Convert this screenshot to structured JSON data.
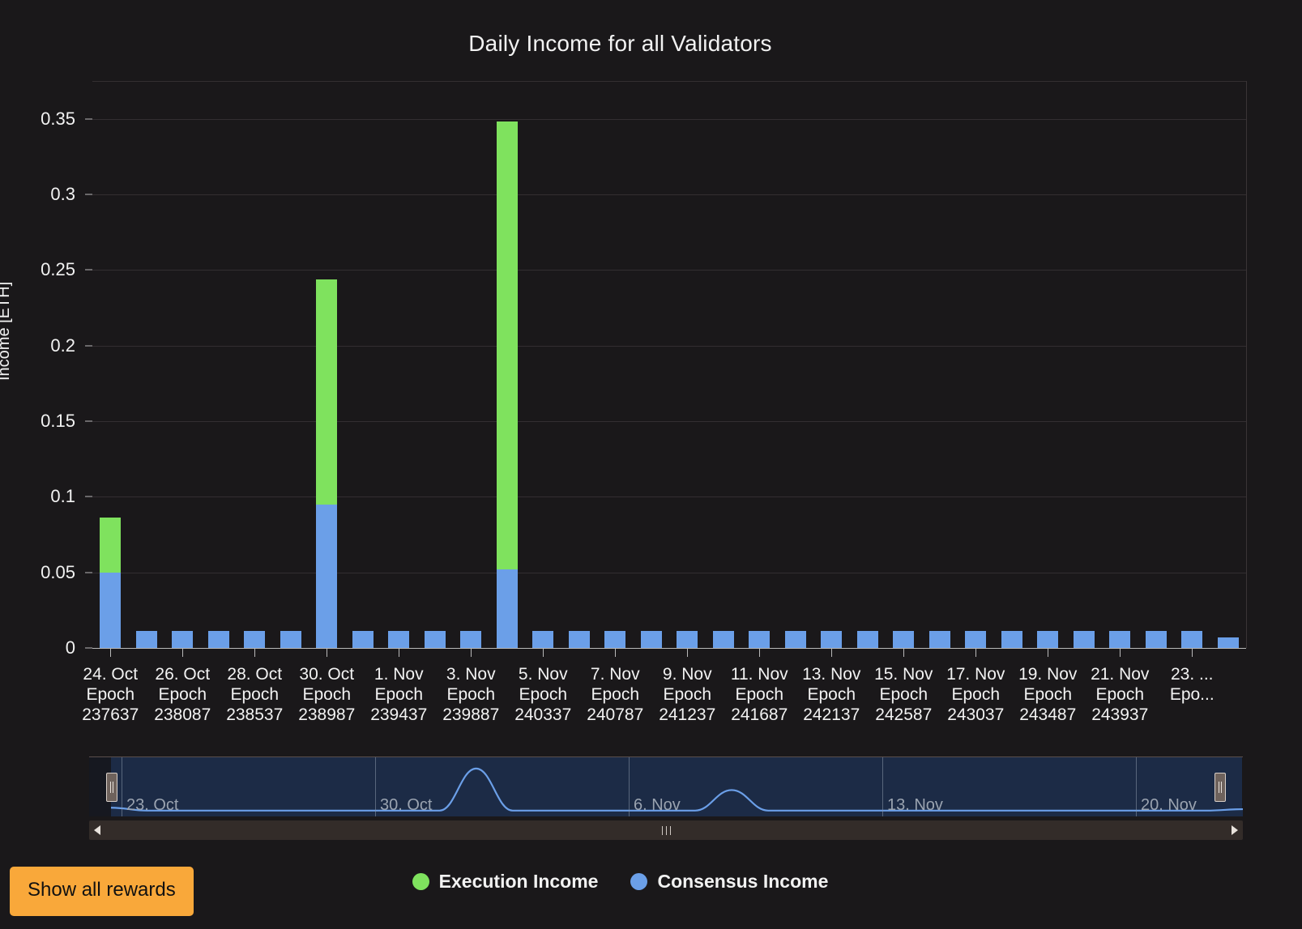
{
  "chart_data": {
    "type": "bar",
    "title": "Daily Income for all Validators",
    "xlabel": "",
    "ylabel": "Income [ETH]",
    "ylim": [
      0,
      0.375
    ],
    "yticks": [
      "0",
      "0.05",
      "0.1",
      "0.15",
      "0.2",
      "0.25",
      "0.3",
      "0.35"
    ],
    "ytick_values": [
      0,
      0.05,
      0.1,
      0.15,
      0.2,
      0.25,
      0.3,
      0.35
    ],
    "grid": true,
    "stacked": true,
    "legend_position": "bottom",
    "colors": {
      "execution": "#7fe25e",
      "consensus": "#6b9fe8",
      "background": "#1a181a",
      "gridline": "#332e31",
      "axis": "#b9b9b9",
      "text": "#f2f2f2",
      "button": "#f9a83a",
      "navigator_fill": "#1c2b46",
      "navigator_line": "#6b9fe8"
    },
    "categories": [
      "24. Oct\nEpoch\n237637",
      "",
      "26. Oct\nEpoch\n238087",
      "",
      "28. Oct\nEpoch\n238537",
      "",
      "30. Oct\nEpoch\n238987",
      "",
      "1. Nov\nEpoch\n239437",
      "",
      "3. Nov\nEpoch\n239887",
      "",
      "5. Nov\nEpoch\n240337",
      "",
      "7. Nov\nEpoch\n240787",
      "",
      "9. Nov\nEpoch\n241237",
      "",
      "11. Nov\nEpoch\n241687",
      "",
      "13. Nov\nEpoch\n242137",
      "",
      "15. Nov\nEpoch\n242587",
      "",
      "17. Nov\nEpoch\n243037",
      "",
      "19. Nov\nEpoch\n243487",
      "",
      "21. Nov\nEpoch\n243937",
      "",
      "23. ...\nEpo..."
    ],
    "series": [
      {
        "name": "Consensus Income",
        "color": "#6b9fe8",
        "values": [
          0.05,
          0.011,
          0.011,
          0.011,
          0.011,
          0.011,
          0.095,
          0.011,
          0.011,
          0.011,
          0.011,
          0.052,
          0.011,
          0.011,
          0.011,
          0.011,
          0.011,
          0.011,
          0.011,
          0.011,
          0.011,
          0.011,
          0.011,
          0.011,
          0.011,
          0.011,
          0.011,
          0.011,
          0.011,
          0.011,
          0.011,
          0.007
        ]
      },
      {
        "name": "Execution Income",
        "color": "#7fe25e",
        "values": [
          0.036,
          0,
          0,
          0,
          0,
          0,
          0.149,
          0,
          0,
          0,
          0,
          0.296,
          0,
          0,
          0,
          0,
          0,
          0,
          0,
          0,
          0,
          0,
          0,
          0,
          0,
          0,
          0,
          0,
          0,
          0,
          0,
          0
        ]
      }
    ],
    "xtick_labels": [
      {
        "index": 0,
        "date": "24. Oct",
        "epoch_label": "Epoch",
        "epoch": "237637"
      },
      {
        "index": 2,
        "date": "26. Oct",
        "epoch_label": "Epoch",
        "epoch": "238087"
      },
      {
        "index": 4,
        "date": "28. Oct",
        "epoch_label": "Epoch",
        "epoch": "238537"
      },
      {
        "index": 6,
        "date": "30. Oct",
        "epoch_label": "Epoch",
        "epoch": "238987"
      },
      {
        "index": 8,
        "date": "1. Nov",
        "epoch_label": "Epoch",
        "epoch": "239437"
      },
      {
        "index": 10,
        "date": "3. Nov",
        "epoch_label": "Epoch",
        "epoch": "239887"
      },
      {
        "index": 12,
        "date": "5. Nov",
        "epoch_label": "Epoch",
        "epoch": "240337"
      },
      {
        "index": 14,
        "date": "7. Nov",
        "epoch_label": "Epoch",
        "epoch": "240787"
      },
      {
        "index": 16,
        "date": "9. Nov",
        "epoch_label": "Epoch",
        "epoch": "241237"
      },
      {
        "index": 18,
        "date": "11. Nov",
        "epoch_label": "Epoch",
        "epoch": "241687"
      },
      {
        "index": 20,
        "date": "13. Nov",
        "epoch_label": "Epoch",
        "epoch": "242137"
      },
      {
        "index": 22,
        "date": "15. Nov",
        "epoch_label": "Epoch",
        "epoch": "242587"
      },
      {
        "index": 24,
        "date": "17. Nov",
        "epoch_label": "Epoch",
        "epoch": "243037"
      },
      {
        "index": 26,
        "date": "19. Nov",
        "epoch_label": "Epoch",
        "epoch": "243487"
      },
      {
        "index": 28,
        "date": "21. Nov",
        "epoch_label": "Epoch",
        "epoch": "243937"
      },
      {
        "index": 30,
        "date": "23. ...",
        "epoch_label": "Epo...",
        "epoch": ""
      }
    ]
  },
  "legend": {
    "items": [
      {
        "label": "Execution Income",
        "color": "#7fe25e"
      },
      {
        "label": "Consensus Income",
        "color": "#6b9fe8"
      }
    ]
  },
  "navigator": {
    "date_labels": [
      "23. Oct",
      "30. Oct",
      "6. Nov",
      "13. Nov",
      "20. Nov"
    ],
    "left_handle": "navigator-left-handle",
    "right_handle": "navigator-right-handle",
    "series_points": [
      0.08,
      0.02,
      0.02,
      0.02,
      0.02,
      0.02,
      0.02,
      0.02,
      0.02,
      0.02,
      0.9,
      0.02,
      0.02,
      0.02,
      0.02,
      0.02,
      0.02,
      0.45,
      0.02,
      0.02,
      0.02,
      0.02,
      0.02,
      0.02,
      0.02,
      0.02,
      0.02,
      0.02,
      0.02,
      0.02,
      0.02,
      0.05
    ]
  },
  "controls": {
    "show_all_rewards": "Show all rewards",
    "scroll_left": "scroll-left",
    "scroll_right": "scroll-right"
  }
}
